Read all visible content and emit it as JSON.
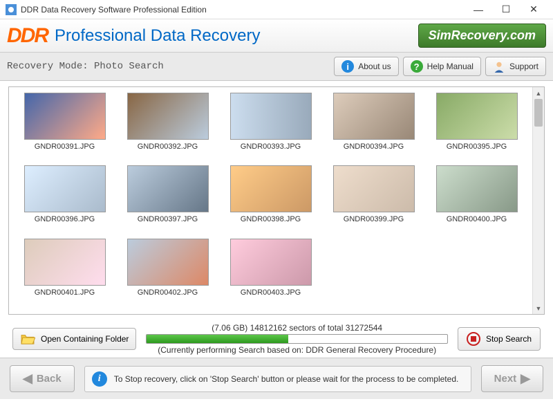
{
  "window": {
    "title": "DDR Data Recovery Software Professional Edition"
  },
  "header": {
    "logo_text": "DDR",
    "title": "Professional Data Recovery",
    "brand": "SimRecovery.com"
  },
  "toolbar": {
    "mode_label": "Recovery Mode: Photo Search",
    "about_label": "About us",
    "help_label": "Help Manual",
    "support_label": "Support"
  },
  "thumbs": [
    {
      "name": "GNDR00391.JPG"
    },
    {
      "name": "GNDR00392.JPG"
    },
    {
      "name": "GNDR00393.JPG"
    },
    {
      "name": "GNDR00394.JPG"
    },
    {
      "name": "GNDR00395.JPG"
    },
    {
      "name": "GNDR00396.JPG"
    },
    {
      "name": "GNDR00397.JPG"
    },
    {
      "name": "GNDR00398.JPG"
    },
    {
      "name": "GNDR00399.JPG"
    },
    {
      "name": "GNDR00400.JPG"
    },
    {
      "name": "GNDR00401.JPG"
    },
    {
      "name": "GNDR00402.JPG"
    },
    {
      "name": "GNDR00403.JPG"
    }
  ],
  "progress": {
    "open_folder_label": "Open Containing Folder",
    "stats_line": "(7.06 GB) 14812162  sectors  of  total 31272544",
    "sub_line": "(Currently performing Search based on:  DDR General Recovery Procedure)",
    "stop_label": "Stop Search",
    "percent": 47
  },
  "footer": {
    "back_label": "Back",
    "next_label": "Next",
    "tip_text": "To Stop recovery, click on 'Stop Search' button or please wait for the process to be completed."
  }
}
